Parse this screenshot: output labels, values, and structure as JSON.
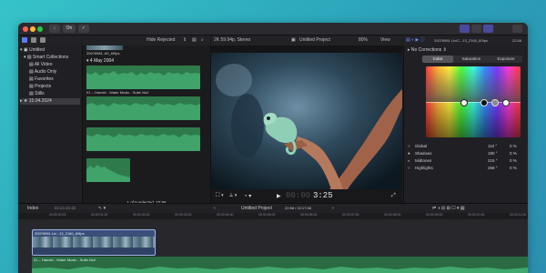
{
  "toolbar": {
    "traffic_colors": [
      "#ff5f57",
      "#febc2e",
      "#28c840"
    ],
    "import_label": "↓",
    "keywords_label": "On",
    "check_label": "✓"
  },
  "library": {
    "header_filter": "Hide Rejected",
    "items": [
      {
        "label": "Untitled",
        "level": 0
      },
      {
        "label": "Smart Collections",
        "level": 1
      },
      {
        "label": "All Video",
        "level": 2
      },
      {
        "label": "Audio Only",
        "level": 2
      },
      {
        "label": "Favorites",
        "level": 2
      },
      {
        "label": "Projects",
        "level": 2
      },
      {
        "label": "Stills",
        "level": 2
      },
      {
        "label": "15.04.2024",
        "level": 1
      }
    ]
  },
  "browser": {
    "top_clip_name": "20076981..69_60fps",
    "date_header": "4 May 2004",
    "audio_clip_name": "01 – Handel - Water Music - Suite No2",
    "status": "1 of 5 selected, 22:58"
  },
  "viewer": {
    "format": "2K 59.94p, Stereo",
    "project": "Untitled Project",
    "zoom": "80%",
    "view": "View",
    "timecode": "00:00",
    "timecode_bright": "3:25"
  },
  "inspector": {
    "clip_name": "20076981 Liv/C...13_2160_60fps",
    "clip_duration": "22:58",
    "corrections": "No Corrections",
    "tabs": [
      "Color",
      "Saturation",
      "Exposure"
    ],
    "rows": [
      {
        "label": "Global",
        "value": "110 °",
        "pct": "0  %"
      },
      {
        "label": "Shadows",
        "value": "180 °",
        "pct": "0  %"
      },
      {
        "label": "Midtones",
        "value": "215 °",
        "pct": "0  %"
      },
      {
        "label": "Highlights",
        "value": "258 °",
        "pct": "0  %"
      }
    ]
  },
  "timeline": {
    "index": "Index",
    "project": "Untitled Project",
    "duration": "22:58 / 22:17:56",
    "ruler_marks": [
      "00:00:00:00",
      "00:00:01:00",
      "00:00:02:00",
      "00:00:03:00",
      "00:00:04:00",
      "00:00:05:00",
      "00:00:06:00",
      "00:00:07:00",
      "00:00:08:00",
      "00:00:09:00",
      "00:00:10:00",
      "00:00:11:00"
    ],
    "video_clip": "20076981 Liv...13_2160_60fps",
    "audio_clip": "01 – Handel - Water Music - Suite No2"
  }
}
